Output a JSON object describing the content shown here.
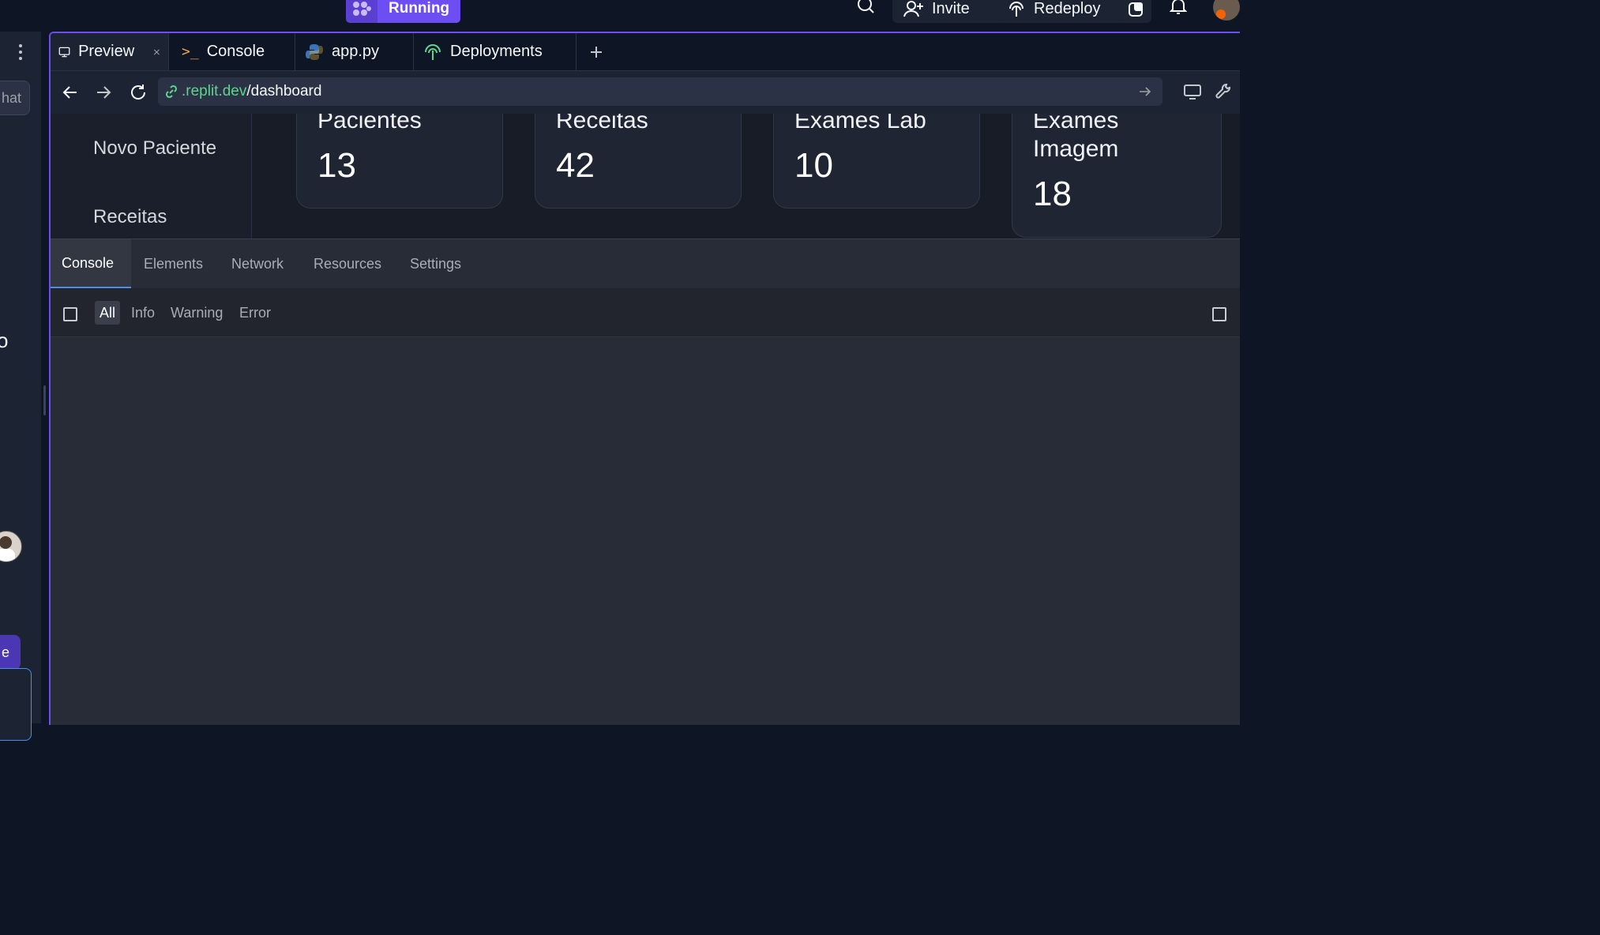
{
  "topbar": {
    "run_status": "Running",
    "invite_label": "Invite",
    "redeploy_label": "Redeploy"
  },
  "leftpane": {
    "chat_fragment": "hat",
    "mid_fragment": "o",
    "bottom_fragment": "e"
  },
  "tabs": [
    {
      "label": "Preview",
      "icon": "monitor-icon",
      "active": true
    },
    {
      "label": "Console",
      "icon": "terminal-icon"
    },
    {
      "label": "app.py",
      "icon": "python-icon"
    },
    {
      "label": "Deployments",
      "icon": "deployments-icon"
    }
  ],
  "url": {
    "domain": ".replit.dev",
    "path": "/dashboard"
  },
  "app": {
    "nav": [
      "Novo Paciente",
      "Receitas"
    ],
    "cards": [
      {
        "title": "Pacientes",
        "value": "13"
      },
      {
        "title": "Receitas",
        "value": "42"
      },
      {
        "title": "Exames Lab",
        "value": "10"
      },
      {
        "title": "Exames Imagem",
        "value": "18"
      }
    ]
  },
  "devtools": {
    "tabs": [
      "Console",
      "Elements",
      "Network",
      "Resources",
      "Settings"
    ],
    "levels": [
      "All",
      "Info",
      "Warning",
      "Error"
    ]
  },
  "colors": {
    "accent": "#6c4ef2",
    "url_domain": "#5fd38d"
  }
}
